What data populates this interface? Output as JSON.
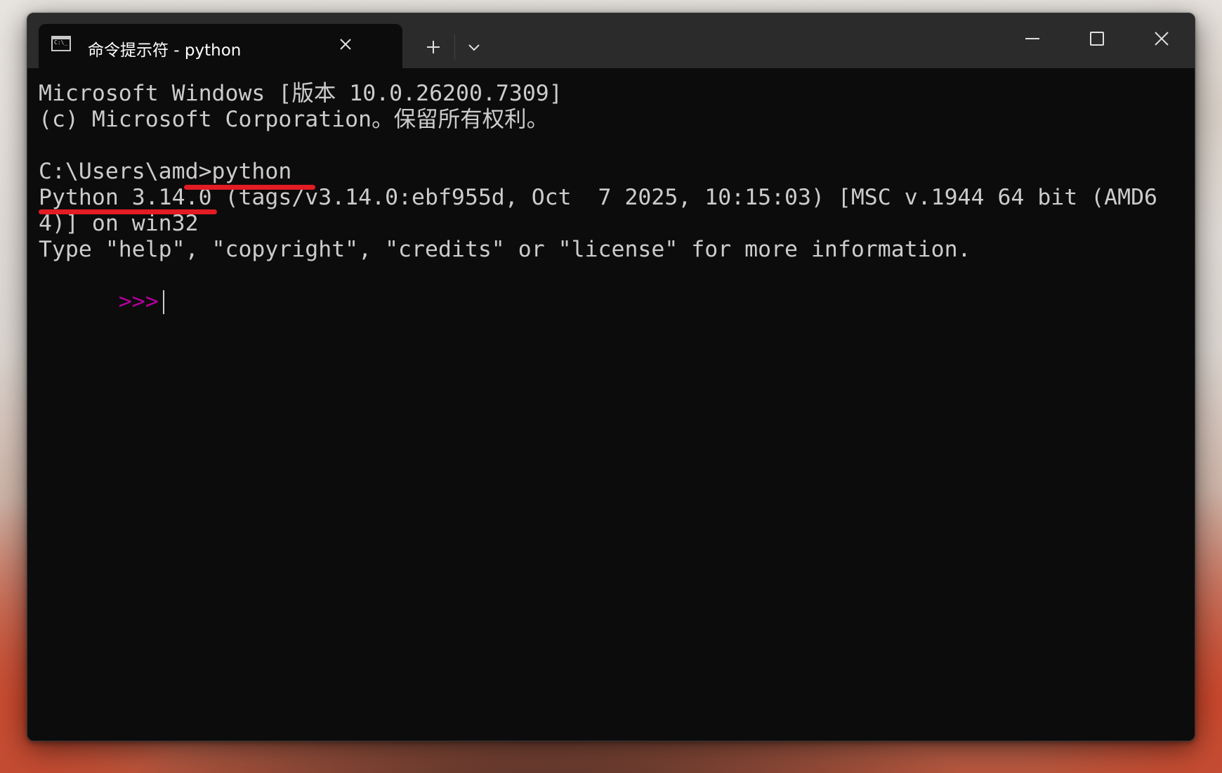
{
  "window": {
    "tab_title": "命令提示符 - python",
    "tab_icon": "terminal-icon",
    "tab_icon_glyph": "C:\\_",
    "buttons": {
      "new_tab": "plus-icon",
      "dropdown": "chevron-down-icon",
      "minimize": "minimize-icon",
      "maximize": "maximize-icon",
      "close": "close-icon"
    }
  },
  "terminal": {
    "lines": [
      "Microsoft Windows [版本 10.0.26200.7309]",
      "(c) Microsoft Corporation。保留所有权利。",
      "",
      "C:\\Users\\amd>python",
      "Python 3.14.0 (tags/v3.14.0:ebf955d, Oct  7 2025, 10:15:03) [MSC v.1944 64 bit (AMD6",
      "4)] on win32",
      "Type \"help\", \"copyright\", \"credits\" or \"license\" for more information."
    ],
    "prompt": ">>>",
    "prompt_color": "#b4009e",
    "text_color": "#cccccc",
    "background": "#0c0c0c"
  },
  "annotations": {
    "color": "#e31b23"
  }
}
